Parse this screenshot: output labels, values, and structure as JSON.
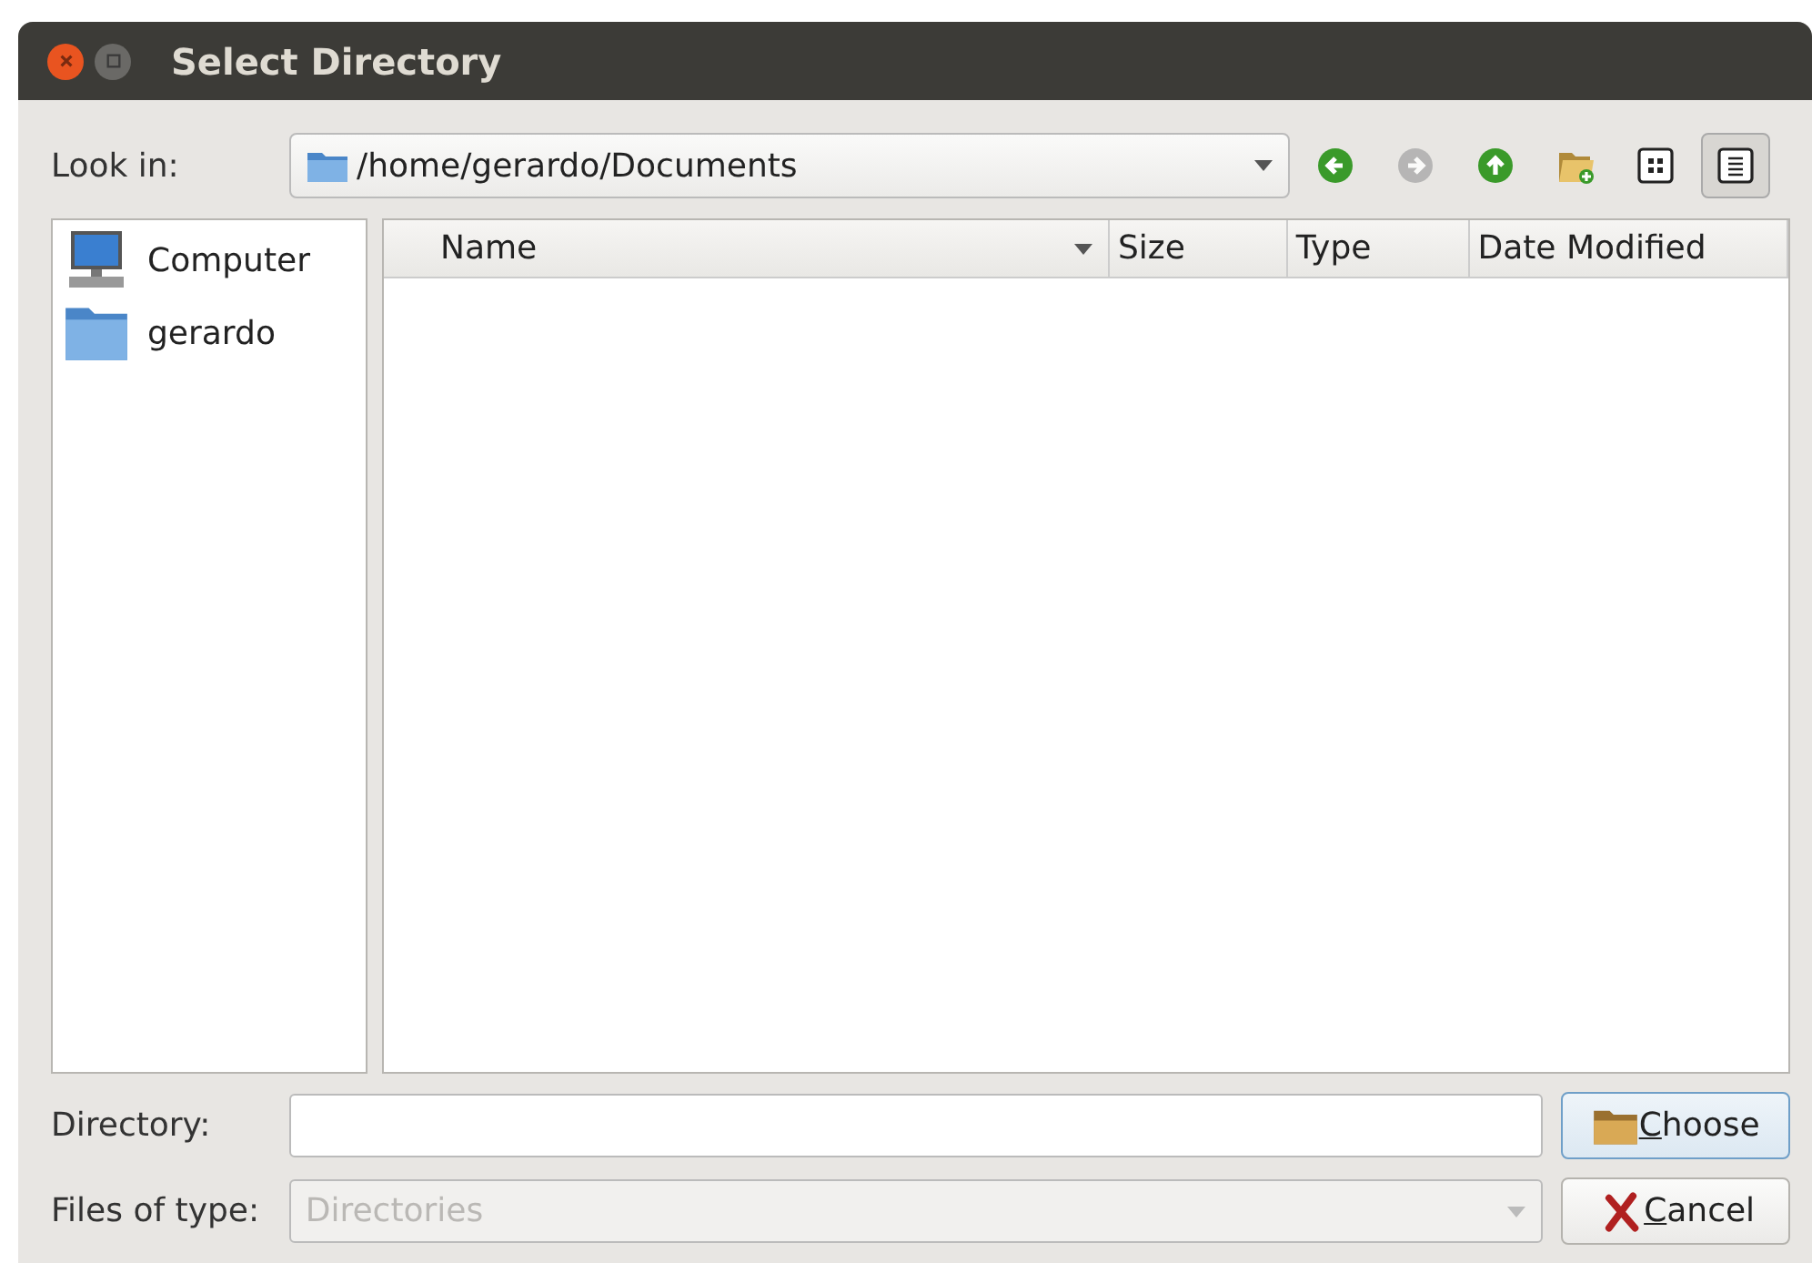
{
  "window": {
    "title": "Select Directory"
  },
  "look_in": {
    "label": "Look in:",
    "path": "/home/gerardo/Documents"
  },
  "toolbar": [
    {
      "kind": "back",
      "disabled": false,
      "selected": false
    },
    {
      "kind": "forward",
      "disabled": true,
      "selected": false
    },
    {
      "kind": "up",
      "disabled": false,
      "selected": false
    },
    {
      "kind": "new-folder",
      "disabled": false,
      "selected": false
    },
    {
      "kind": "list-view",
      "disabled": false,
      "selected": false
    },
    {
      "kind": "detail-view",
      "disabled": false,
      "selected": true
    }
  ],
  "places": [
    {
      "kind": "computer",
      "label": "Computer"
    },
    {
      "kind": "folder",
      "label": "gerardo"
    }
  ],
  "columns": [
    {
      "label": "Name",
      "sorted": true
    },
    {
      "label": "Size",
      "sorted": false
    },
    {
      "label": "Type",
      "sorted": false
    },
    {
      "label": "Date Modified",
      "sorted": false
    }
  ],
  "directory": {
    "label": "Directory:"
  },
  "file_type": {
    "label": "Files of type:",
    "value": "Directories",
    "disabled": true
  },
  "buttons": [
    {
      "kind": "choose",
      "label": "Choose",
      "default": true
    },
    {
      "kind": "cancel",
      "label": "Cancel",
      "default": false
    }
  ]
}
